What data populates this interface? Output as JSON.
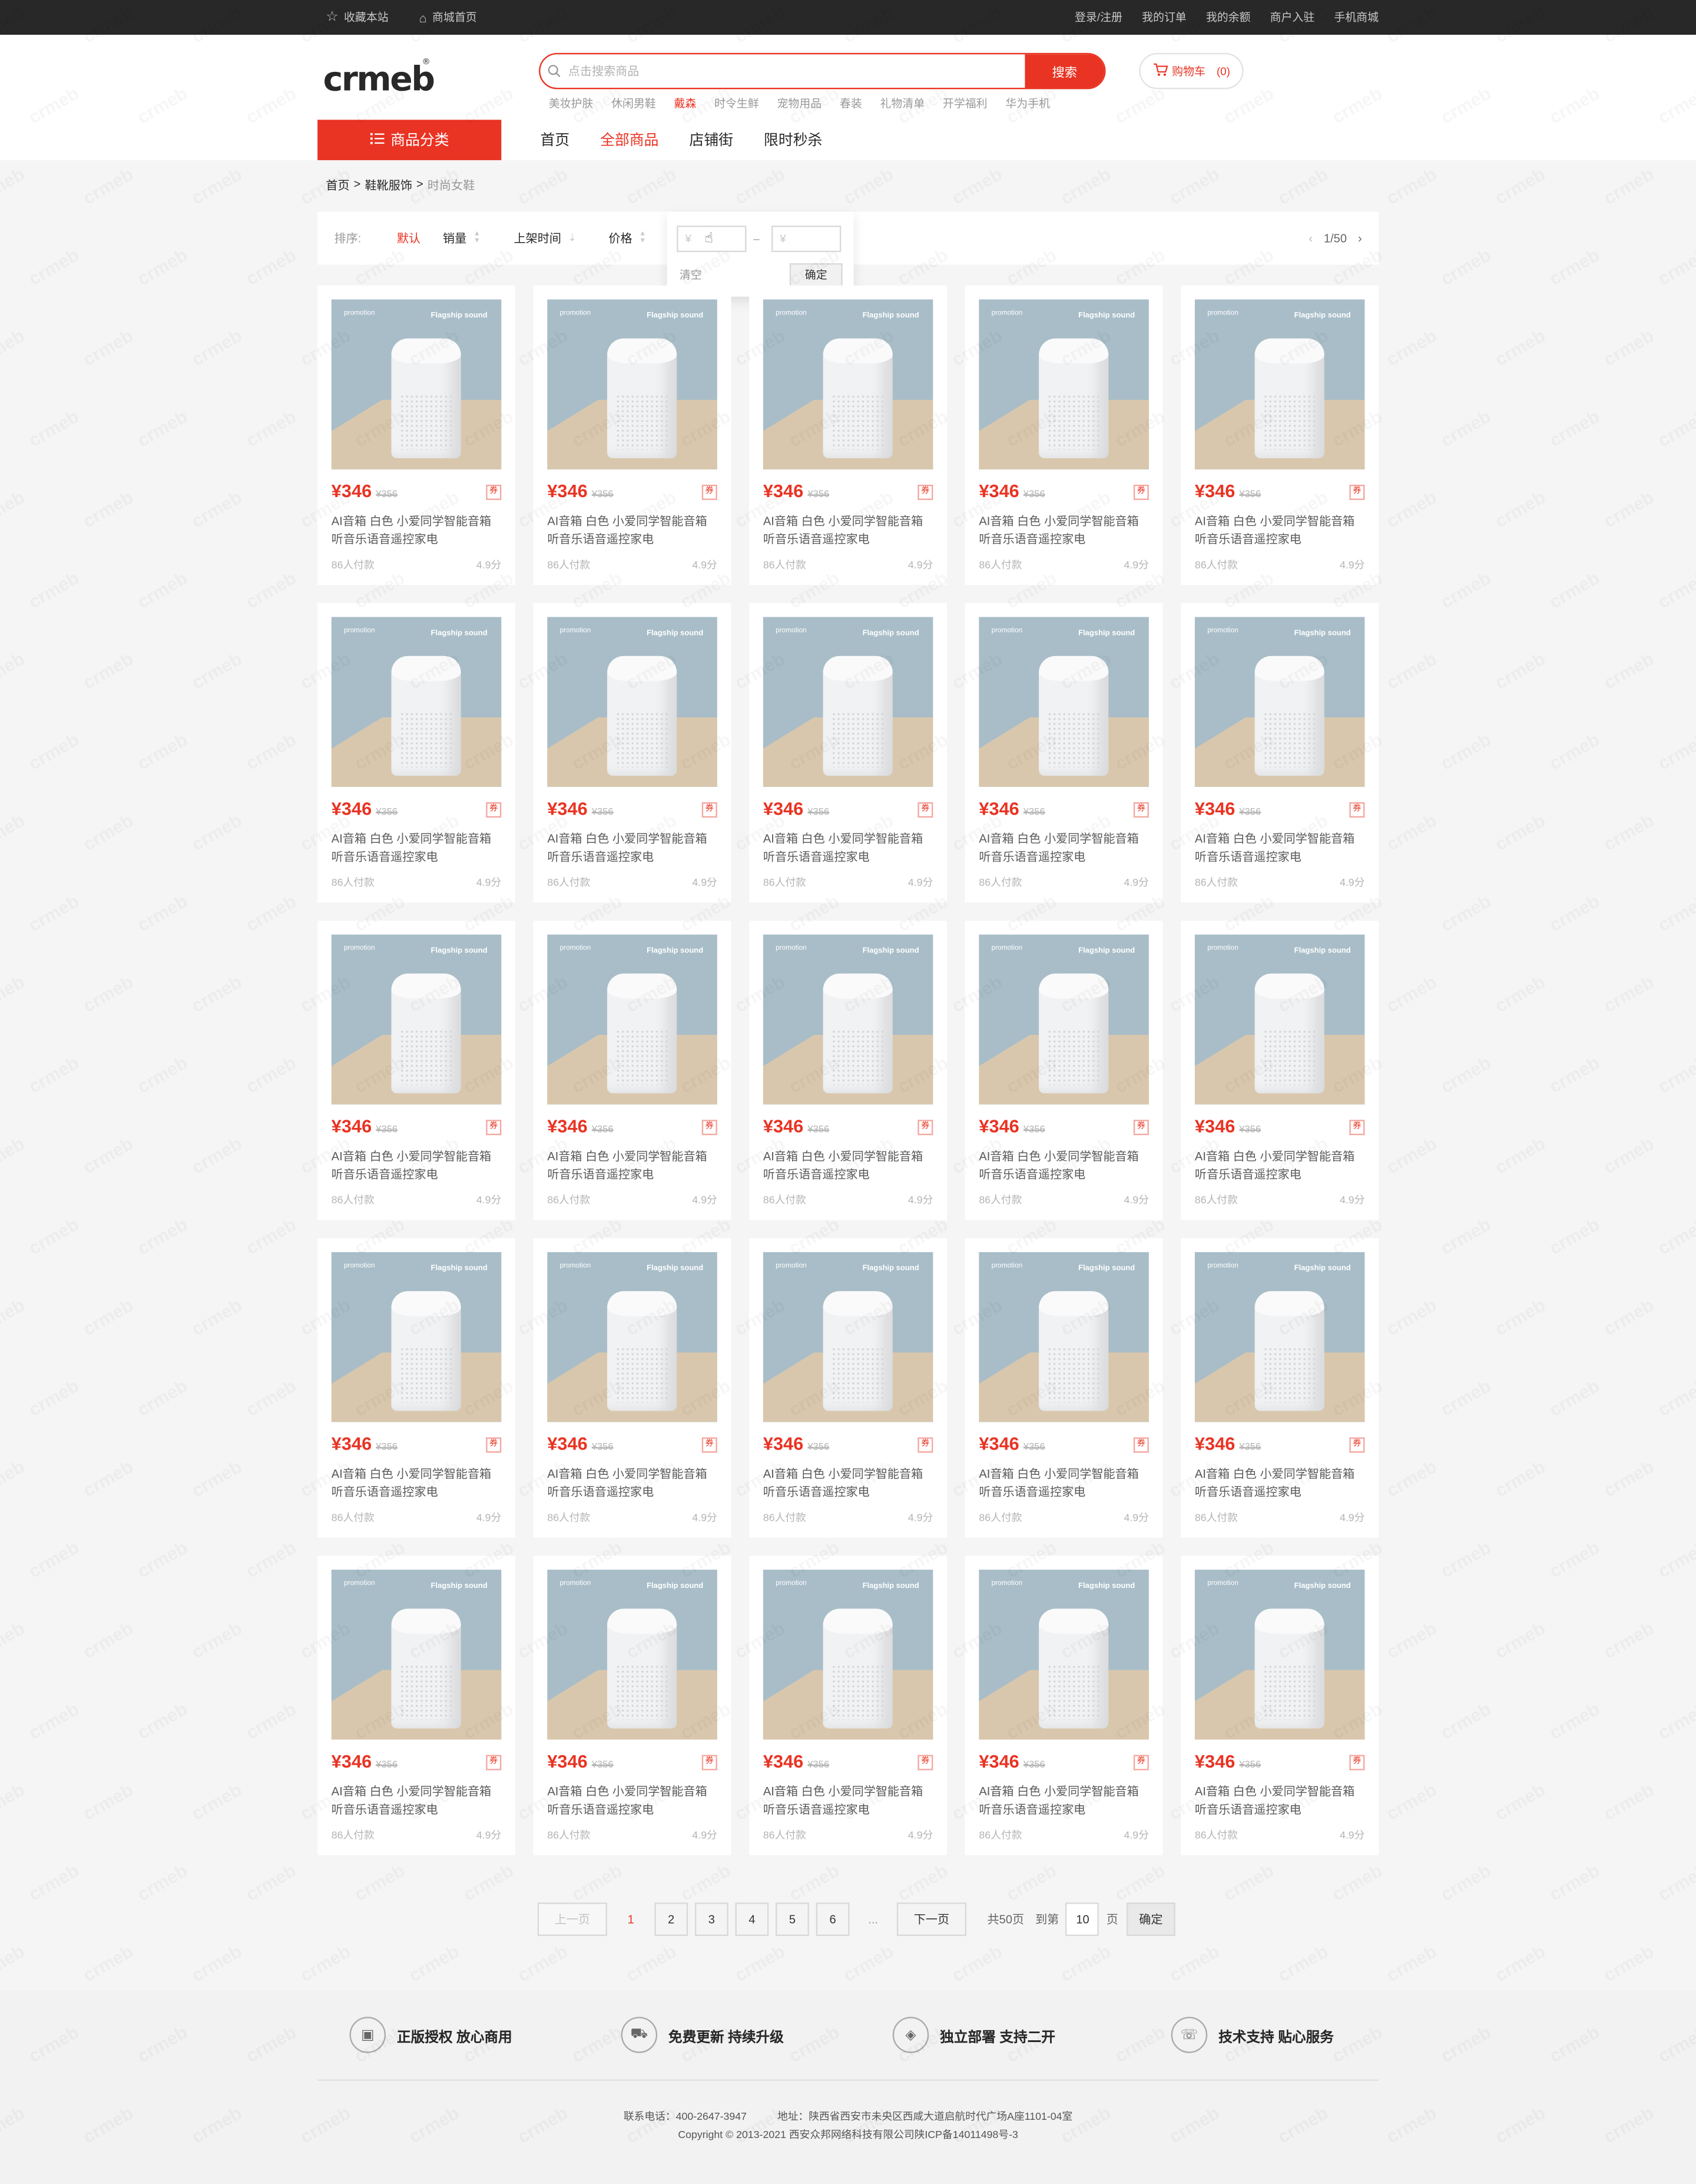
{
  "topbar": {
    "bookmark": "收藏本站",
    "home": "商城首页",
    "links": [
      "登录/注册",
      "我的订单",
      "我的余额",
      "商户入驻",
      "手机商城"
    ]
  },
  "header": {
    "logo_text": "crmeb",
    "search_placeholder": "点击搜索商品",
    "search_button": "搜索",
    "cart_label": "购物车",
    "cart_count": "(0)",
    "hot_words": [
      "美妆护肤",
      "休闲男鞋",
      "戴森",
      "时令生鲜",
      "宠物用品",
      "春装",
      "礼物清单",
      "开学福利",
      "华为手机"
    ],
    "hot_active_index": 2,
    "category_button": "商品分类",
    "nav": [
      "首页",
      "全部商品",
      "店铺街",
      "限时秒杀"
    ],
    "nav_active_index": 1
  },
  "breadcrumb": [
    "首页",
    "鞋靴服饰",
    "时尚女鞋"
  ],
  "filter": {
    "label": "排序:",
    "sorts": [
      "默认",
      "销量",
      "上架时间",
      "价格"
    ],
    "active_index": 0,
    "min_placeholder": "¥",
    "max_placeholder": "¥",
    "dash": "–",
    "clear": "清空",
    "confirm": "确定",
    "page_indicator": "1/50",
    "prev_arrow": "‹",
    "next_arrow": "›"
  },
  "products": [
    {
      "price": "¥346",
      "original_price": "¥356",
      "coupon": "券",
      "name": "AI音箱 白色 小爱同学智能音箱听音乐语音遥控家电",
      "sold": "86人付款",
      "score": "4.9分",
      "tag": "Flagship sound",
      "mark": "promotion"
    }
  ],
  "product_count": 25,
  "pagination": {
    "prev": "上一页",
    "pages": [
      "1",
      "2",
      "3",
      "4",
      "5",
      "6"
    ],
    "current": "1",
    "ellipsis": "...",
    "next": "下一页",
    "total": "共50页",
    "goto_label": "到第",
    "goto_value": "10",
    "page_unit": "页",
    "confirm": "确定"
  },
  "footer": {
    "guarantees": [
      "正版授权 放心商用",
      "免费更新 持续升级",
      "独立部署 支持二开",
      "技术支持 贴心服务"
    ],
    "phone": "联系电话：400-2647-3947",
    "address": "地址：陕西省西安市未央区西咸大道启航时代广场A座1101-04室",
    "copyright": "Copyright © 2013-2021 西安众邦网络科技有限公司陕ICP备14011498号-3"
  },
  "colors": {
    "accent": "#e93323",
    "topbar": "#282828"
  },
  "icons": {
    "bookmark": "star-icon",
    "home": "home-icon",
    "search": "search-icon",
    "cart": "cart-icon",
    "menu": "list-icon"
  }
}
